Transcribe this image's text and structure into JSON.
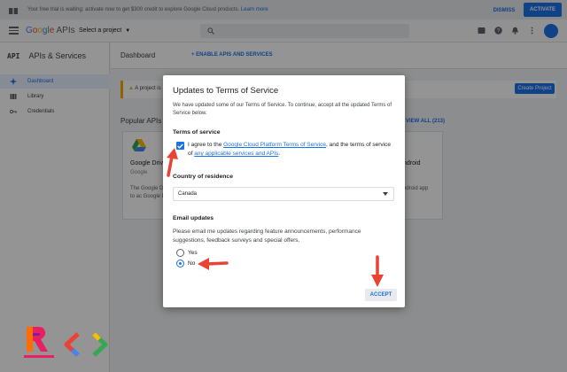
{
  "banner": {
    "message": "Your free trial is waiting: activate now to get $300 credit to explore Google Cloud products.",
    "learn_more": "Learn more",
    "dismiss": "DISMISS",
    "activate": "ACTIVATE"
  },
  "header": {
    "logo_g": [
      "G",
      "o",
      "o",
      "g",
      "l",
      "e"
    ],
    "logo_apis": "APIs",
    "project_selector": "Select a project"
  },
  "sidebar": {
    "api_mark": "API",
    "title": "APIs & Services",
    "items": [
      {
        "label": "Dashboard",
        "active": true
      },
      {
        "label": "Library",
        "active": false
      },
      {
        "label": "Credentials",
        "active": false
      }
    ]
  },
  "main": {
    "title": "Dashboard",
    "enable_apis": "ENABLE APIS AND SERVICES",
    "notice": "A project is",
    "create_project": "Create Project",
    "popular_apis": "Popular APIs",
    "view_all": "VIEW ALL (213)",
    "cards": [
      {
        "name": "Google Drive",
        "provider": "Google",
        "description": "The Google D clients to ac Google Drive"
      },
      {
        "name": "ndroid",
        "provider": "",
        "description": "ndroid app"
      }
    ]
  },
  "dialog": {
    "title": "Updates to Terms of Service",
    "intro": "We have updated some of our Terms of Service. To continue, accept all the updated Terms of Service below.",
    "terms_heading": "Terms of service",
    "agree_prefix": "I agree to the ",
    "agree_link1": "Google Cloud Platform Terms of Service",
    "agree_middle": ", and the terms of service of ",
    "agree_link2": "any applicable services and APIs",
    "agree_suffix": ".",
    "agree_checked": true,
    "country_heading": "Country of residence",
    "country_value": "Canada",
    "email_heading": "Email updates",
    "email_text": "Please email me updates regarding feature announcements, performance suggestions, feedback surveys and special offers.",
    "radio_yes": "Yes",
    "radio_no": "No",
    "selected_option": "No",
    "accept": "ACCEPT"
  },
  "colors": {
    "accent": "#1a73e8",
    "annotation_arrow": "#ea4335"
  }
}
